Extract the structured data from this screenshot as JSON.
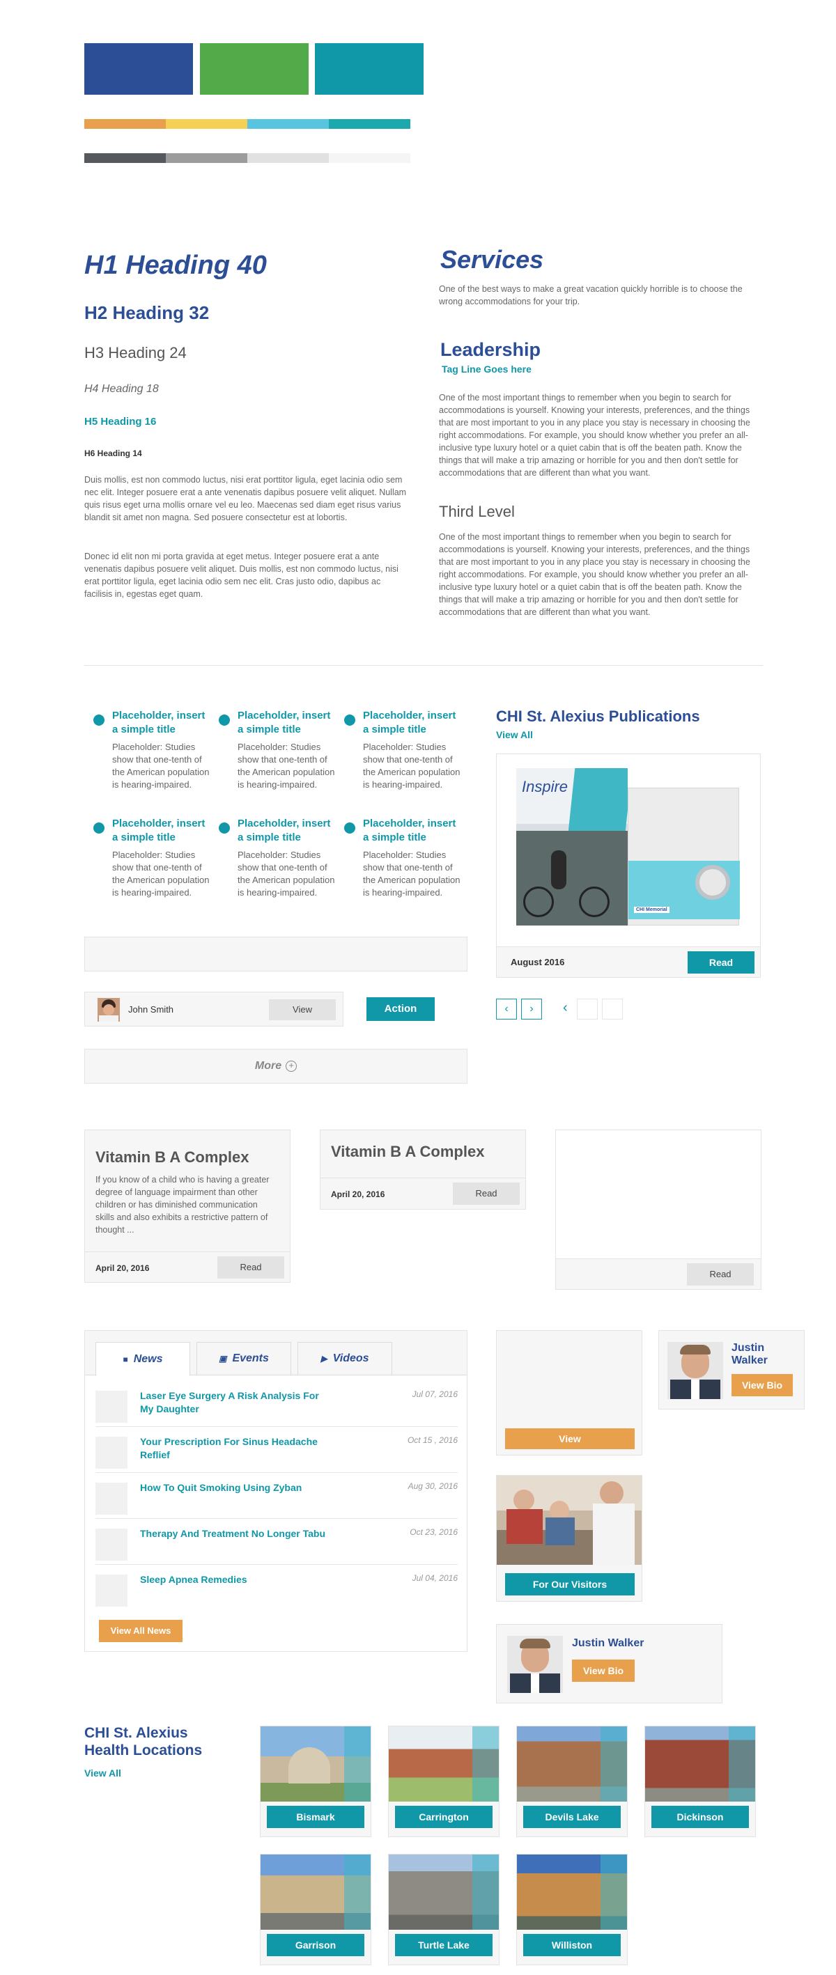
{
  "palette": {
    "primary": [
      "#2c4e96",
      "#52ab48",
      "#1097a8"
    ],
    "accents": [
      "#e9a04c",
      "#f6cf57",
      "#59c4e0",
      "#1ba9ad"
    ],
    "greys": [
      "#55585c",
      "#9c9c9c",
      "#e1e1e1",
      "#f5f5f5"
    ]
  },
  "typography": {
    "h1": "H1 Heading 40",
    "h2": "H2 Heading 32",
    "h3": "H3 Heading 24",
    "h4": "H4 Heading 18",
    "h5": "H5 Heading 16",
    "h6": "H6 Heading 14",
    "para1": "Duis mollis, est non commodo luctus, nisi erat porttitor ligula, eget lacinia odio sem nec elit. Integer posuere erat a ante venenatis dapibus posuere velit aliquet. Nullam quis risus eget urna mollis ornare vel eu leo. Maecenas sed diam eget risus varius blandit sit amet non magna. Sed posuere consectetur est at lobortis.",
    "para2": "Donec id elit non mi porta gravida at eget metus. Integer posuere erat a ante venenatis dapibus posuere velit aliquet. Duis mollis, est non commodo luctus, nisi erat porttitor ligula, eget lacinia odio sem nec elit. Cras justo odio, dapibus ac facilisis in, egestas eget quam."
  },
  "services": {
    "title": "Services",
    "text": "One of the best ways to make a great vacation quickly horrible is to choose the wrong accommodations for your trip.",
    "leadership_title": "Leadership",
    "tagline": "Tag Line Goes here",
    "leadership_text": "One of the most important things to remember when you begin to search for accommodations is yourself. Knowing your interests, preferences, and the things that are most important to you in any place you stay is necessary in choosing the right accommodations. For example, you should know whether you prefer an all-inclusive type luxury hotel or a quiet cabin that is off the beaten path. Know the things that will make a trip amazing or horrible for you and then don't settle for accommodations that are different than what you want.",
    "third_title": "Third Level",
    "third_text": "One of the most important things to remember when you begin to search for accommodations is yourself. Knowing your interests, preferences, and the things that are most important to you in any place you stay is necessary in choosing the right accommodations. For example, you should know whether you prefer an all-inclusive type luxury hotel or a quiet cabin that is off the beaten path. Know the things that will make a trip amazing or horrible for you and then don't settle for accommodations that are different than what you want."
  },
  "placeholders": {
    "title": "Placeholder, insert a simple title",
    "body": "Placeholder: Studies show that one-tenth of the American population is hearing-impaired."
  },
  "person_row": {
    "name": "John Smith",
    "view": "View",
    "action": "Action"
  },
  "more": {
    "label": "More"
  },
  "publications": {
    "title": "CHI St. Alexius Publications",
    "view_all": "View All",
    "cover_title": "Inspire",
    "cover_brand": "CHI Memorial",
    "date": "August 2016",
    "read": "Read"
  },
  "vitamin_cards": {
    "title": "Vitamin B A Complex",
    "body": "If you know of a child who is having a greater degree of language impairment than other children or has diminished communication skills and also exhibits a restrictive pattern of thought ...",
    "date": "April 20, 2016",
    "read": "Read"
  },
  "news": {
    "tabs": [
      "News",
      "Events",
      "Videos"
    ],
    "items": [
      {
        "title": "Laser Eye Surgery A Risk Analysis For My Daughter",
        "date": "Jul 07, 2016"
      },
      {
        "title": "Your Prescription For Sinus Headache Reflief",
        "date": "Oct 15 , 2016"
      },
      {
        "title": "How To Quit Smoking Using Zyban",
        "date": "Aug 30, 2016"
      },
      {
        "title": "Therapy And Treatment No Longer Tabu",
        "date": "Oct 23, 2016"
      },
      {
        "title": "Sleep Apnea Remedies",
        "date": "Jul 04, 2016"
      }
    ],
    "view_all": "View All News"
  },
  "side": {
    "view": "View",
    "visitors": "For Our Visitors",
    "doctor_name": "Justin Walker",
    "view_bio": "View Bio"
  },
  "locations": {
    "title": "CHI St. Alexius Health Locations",
    "view_all": "View All",
    "items": [
      "Bismark",
      "Carrington",
      "Devils Lake",
      "Dickinson",
      "Garrison",
      "Turtle Lake",
      "Williston"
    ]
  }
}
